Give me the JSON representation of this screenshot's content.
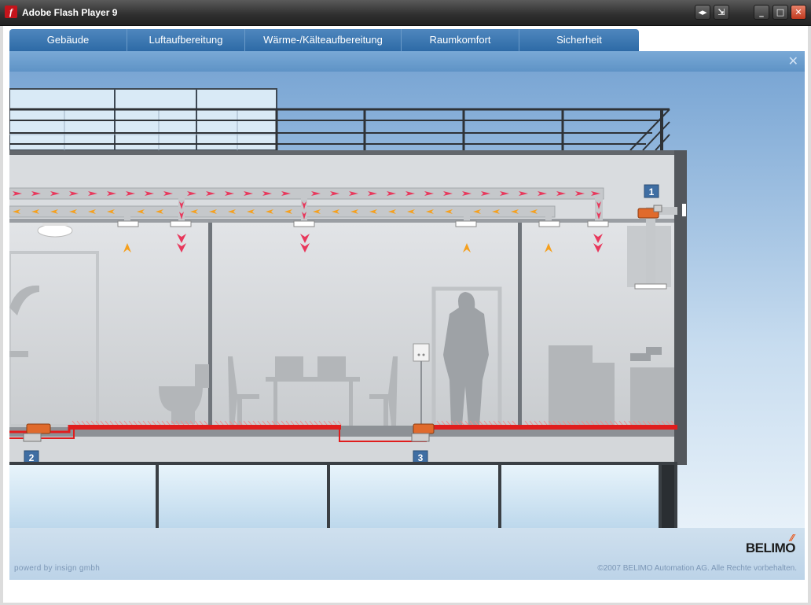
{
  "window": {
    "title": "Adobe Flash Player 9"
  },
  "tabs": [
    {
      "label": "Gebäude"
    },
    {
      "label": "Luftaufbereitung"
    },
    {
      "label": "Wärme-/Kälteaufbereitung"
    },
    {
      "label": "Raumkomfort"
    },
    {
      "label": "Sicherheit"
    }
  ],
  "markers": {
    "one": "1",
    "two": "2",
    "three": "3"
  },
  "footer": {
    "powered": "powerd by insign gmbh",
    "copyright": "©2007 BELIMO Automation AG. Alle Rechte vorbehalten.",
    "logo": "BELIMO"
  },
  "colors": {
    "accent": "#2d6aa6",
    "supply": "#e8385c",
    "return": "#f5a01e",
    "heating": "#e01d1d"
  }
}
